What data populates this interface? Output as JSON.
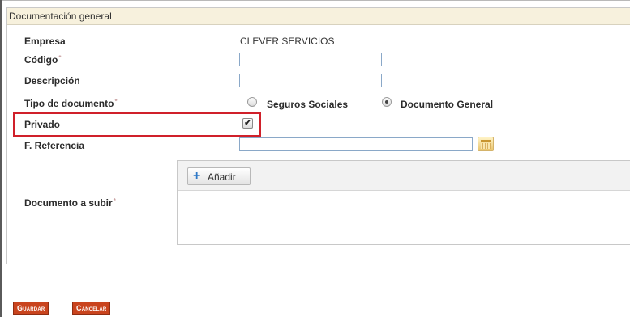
{
  "panel": {
    "title": "Documentación general"
  },
  "fields": {
    "empresa": {
      "label": "Empresa",
      "value": "CLEVER SERVICIOS"
    },
    "codigo": {
      "label": "Código",
      "required_mark": "*",
      "value": ""
    },
    "descripcion": {
      "label": "Descripción",
      "value": ""
    },
    "tipo_documento": {
      "label": "Tipo de documento",
      "required_mark": "*",
      "options": [
        {
          "label": "Seguros Sociales",
          "selected": false
        },
        {
          "label": "Documento General",
          "selected": true
        }
      ]
    },
    "privado": {
      "label": "Privado",
      "checked": true,
      "check_glyph": "✔"
    },
    "f_referencia": {
      "label": "F. Referencia",
      "value": ""
    },
    "documento_subir": {
      "label": "Documento a subir",
      "required_mark": "*",
      "add_label": "Añadir",
      "add_glyph": "+"
    }
  },
  "actions": {
    "save_label": "Guardar",
    "cancel_label": "Cancelar"
  },
  "colors": {
    "highlight": "#d0202a",
    "header_bg": "#f7f1dd",
    "button_bg": "#c9441e",
    "input_border": "#8aa8c8"
  }
}
